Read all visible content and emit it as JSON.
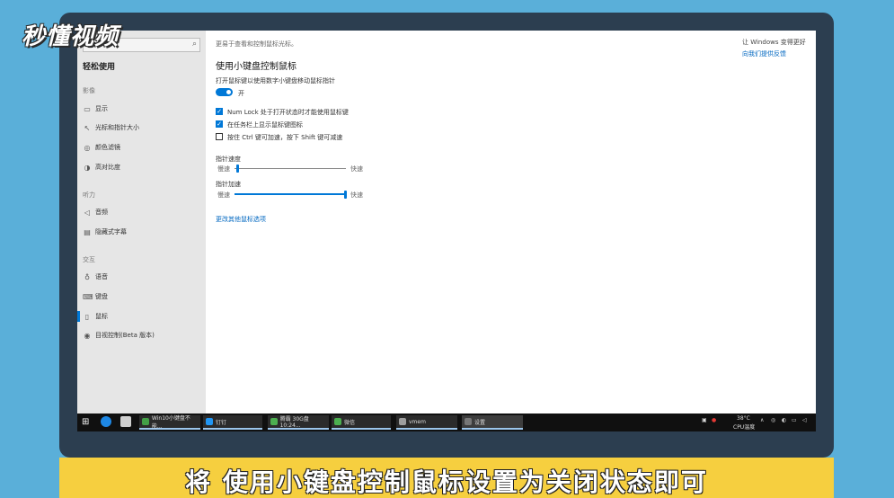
{
  "brand": {
    "logo_text": "秒懂视频"
  },
  "sidebar": {
    "title": "轻松使用",
    "sections": [
      {
        "label": "影像",
        "items": [
          {
            "icon": "display-icon",
            "label": "显示"
          },
          {
            "icon": "cursor-icon",
            "label": "光标和指针大小"
          },
          {
            "icon": "magnifier-icon",
            "label": "颜色滤镜"
          },
          {
            "icon": "contrast-icon",
            "label": "高对比度"
          }
        ]
      },
      {
        "label": "听力",
        "items": [
          {
            "icon": "speaker-icon",
            "label": "音频"
          },
          {
            "icon": "caption-icon",
            "label": "隐藏式字幕"
          }
        ]
      },
      {
        "label": "交互",
        "items": [
          {
            "icon": "microphone-icon",
            "label": "语音"
          },
          {
            "icon": "keyboard-icon",
            "label": "键盘"
          },
          {
            "icon": "mouse-icon",
            "label": "鼠标"
          },
          {
            "icon": "eye-icon",
            "label": "目视控制(Beta 版本)"
          }
        ]
      }
    ]
  },
  "content": {
    "top_desc": "更易于查看和控制鼠标光标。",
    "section_title": "使用小键盘控制鼠标",
    "toggle_label": "打开鼠标键以使用数字小键盘移动鼠标指针",
    "toggle_state": "开",
    "checkboxes": [
      {
        "label": "Num Lock 处于打开状态时才能使用鼠标键",
        "checked": true
      },
      {
        "label": "在任务栏上显示鼠标键图标",
        "checked": true
      },
      {
        "label": "按住 Ctrl 键可加速，按下 Shift 键可减速",
        "checked": false
      }
    ],
    "speed": {
      "label": "指针速度",
      "min_label": "慢速",
      "max_label": "快速",
      "value": 0.02
    },
    "accel": {
      "label": "指针加速",
      "min_label": "慢速",
      "max_label": "快速",
      "value": 1.0
    },
    "more_link": "更改其他鼠标选项",
    "right_title": "让 Windows 变得更好",
    "right_link": "向我们提供反馈"
  },
  "taskbar": {
    "apps": [
      {
        "label": "Win10小键盘不能...",
        "color": "#43a047"
      },
      {
        "label": "钉钉",
        "color": "#2196f3"
      },
      {
        "label": "腾霸 30G盘 10:24...",
        "color": "#4caf50"
      },
      {
        "label": "微信",
        "color": "#4caf50"
      },
      {
        "label": "vmem",
        "color": "#9e9e9e"
      },
      {
        "label": "设置",
        "color": "#555555"
      }
    ],
    "temperature": "38°C",
    "temp_label": "CPU温度"
  },
  "subtitle": {
    "text": "将 使用小键盘控制鼠标设置为关闭状态即可"
  }
}
